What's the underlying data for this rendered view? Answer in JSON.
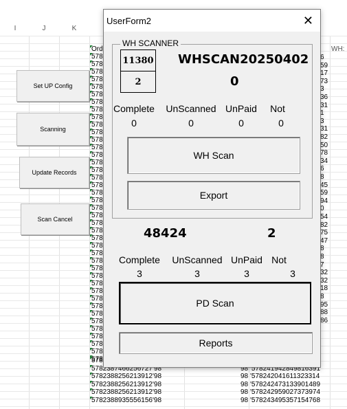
{
  "sheet": {
    "columns": [
      "I",
      "J",
      "K"
    ],
    "far_right_header": "WH:",
    "buttons": {
      "setup": "Set UP Config",
      "scanning": "Scanning",
      "update": "Update Records",
      "cancel": "Scan Cancel"
    },
    "order_header": "Ord",
    "left_col_prefix": "578",
    "right_col_fragments": [
      "6",
      "59",
      "17",
      "73",
      "3",
      "36",
      "31",
      "1",
      "3",
      "31",
      "82",
      "50",
      "78",
      "34",
      "6",
      "8",
      "45",
      "59",
      "94",
      "0",
      "54",
      "82",
      "75",
      "47",
      "8",
      "8",
      "7",
      "32",
      "32",
      "18",
      "8",
      "95",
      "88",
      "86"
    ],
    "bottom_rows": [
      {
        "left": "5782387466256727'98",
        "mid": "98",
        "right": "'578241507401893866"
      },
      {
        "left": "5782387466256727'98",
        "mid": "98",
        "right": "'578241942849816391"
      },
      {
        "left": "5782388256213912'98",
        "mid": "98",
        "right": "'578242041611323314"
      },
      {
        "left": "5782388256213912'98",
        "mid": "98",
        "right": "'578242473133901489"
      },
      {
        "left": "5782388256213912'98",
        "mid": "98",
        "right": "'578242959027373974"
      },
      {
        "left": "5782388935556156'98",
        "mid": "98",
        "right": "'578243495357154768"
      }
    ]
  },
  "dialog": {
    "title": "UserForm2",
    "close": "✕",
    "wh_frame_label": "WH SCANNER",
    "box_top": "11380",
    "box_bottom": "2",
    "wh_scan_id": "WHSCAN20250402",
    "wh_count": "0",
    "wh_stats_labels": [
      "Complete",
      "UnScanned",
      "UnPaid",
      "Not"
    ],
    "wh_stats_values": [
      "0",
      "0",
      "0",
      "0"
    ],
    "wh_scan_button": "WH Scan",
    "export_button": "Export",
    "pd_left_number": "48424",
    "pd_right_number": "2",
    "pd_stats_labels": [
      "Complete",
      "UnScanned",
      "UnPaid",
      "Not"
    ],
    "pd_stats_values": [
      "3",
      "3",
      "3",
      "3"
    ],
    "pd_scan_button": "PD Scan",
    "reports_button": "Reports"
  }
}
